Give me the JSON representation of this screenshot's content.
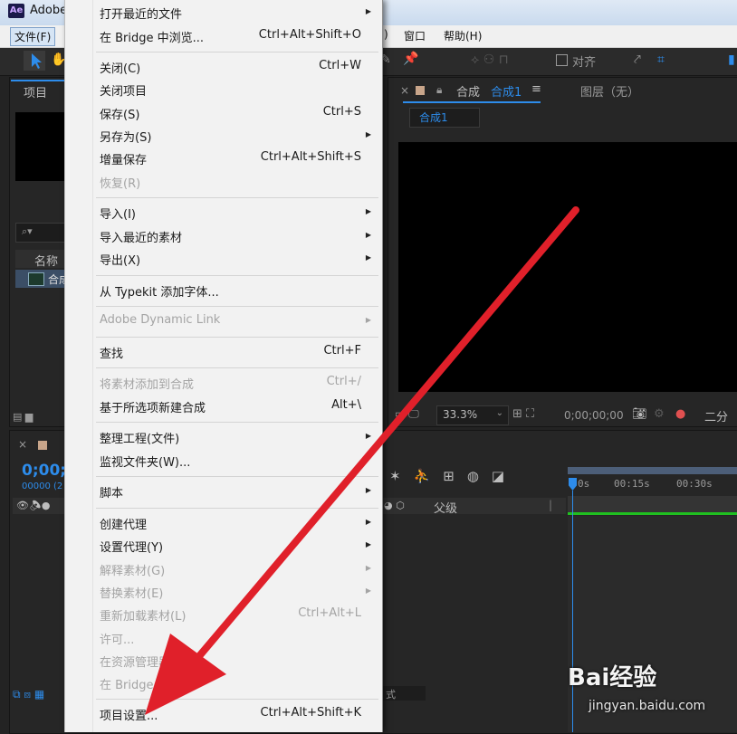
{
  "window": {
    "title": "Adobe"
  },
  "menubar": {
    "file": "文件(F)",
    "window": "窗口",
    "help": "帮助(H)",
    "partial": ")"
  },
  "toolbar": {
    "align": "对齐"
  },
  "project_panel": {
    "tab": "项目",
    "column_name": "名称",
    "item": "合成"
  },
  "comp_panel": {
    "tab_prefix": "合成",
    "tab_active": "合成1",
    "layer_tab": "图层（无）",
    "sub_tab": "合成1",
    "zoom": "33.3%",
    "timecode": "0;00;00;00",
    "resolution": "二分"
  },
  "timeline": {
    "timecode": "0;00;",
    "frame": "00000 (2",
    "parent_label": "父级",
    "ruler": [
      "0s",
      "00:15s",
      "00:30s"
    ],
    "footer": "式"
  },
  "file_menu": {
    "items": [
      {
        "label": "打开最近的文件",
        "shortcut": "",
        "submenu": true,
        "disabled": false
      },
      {
        "label": "在 Bridge 中浏览...",
        "shortcut": "Ctrl+Alt+Shift+O",
        "submenu": false,
        "disabled": false
      },
      {
        "label": "关闭(C)",
        "shortcut": "Ctrl+W",
        "submenu": false,
        "disabled": false
      },
      {
        "label": "关闭项目",
        "shortcut": "",
        "submenu": false,
        "disabled": false
      },
      {
        "label": "保存(S)",
        "shortcut": "Ctrl+S",
        "submenu": false,
        "disabled": false
      },
      {
        "label": "另存为(S)",
        "shortcut": "",
        "submenu": true,
        "disabled": false
      },
      {
        "label": "增量保存",
        "shortcut": "Ctrl+Alt+Shift+S",
        "submenu": false,
        "disabled": false
      },
      {
        "label": "恢复(R)",
        "shortcut": "",
        "submenu": false,
        "disabled": true
      },
      {
        "label": "导入(I)",
        "shortcut": "",
        "submenu": true,
        "disabled": false
      },
      {
        "label": "导入最近的素材",
        "shortcut": "",
        "submenu": true,
        "disabled": false
      },
      {
        "label": "导出(X)",
        "shortcut": "",
        "submenu": true,
        "disabled": false
      },
      {
        "label": "从 Typekit 添加字体...",
        "shortcut": "",
        "submenu": false,
        "disabled": false
      },
      {
        "label": "Adobe Dynamic Link",
        "shortcut": "",
        "submenu": true,
        "disabled": true
      },
      {
        "label": "查找",
        "shortcut": "Ctrl+F",
        "submenu": false,
        "disabled": false
      },
      {
        "label": "将素材添加到合成",
        "shortcut": "Ctrl+/",
        "submenu": false,
        "disabled": true
      },
      {
        "label": "基于所选项新建合成",
        "shortcut": "Alt+\\",
        "submenu": false,
        "disabled": false
      },
      {
        "label": "整理工程(文件)",
        "shortcut": "",
        "submenu": true,
        "disabled": false
      },
      {
        "label": "监视文件夹(W)...",
        "shortcut": "",
        "submenu": false,
        "disabled": false
      },
      {
        "label": "脚本",
        "shortcut": "",
        "submenu": true,
        "disabled": false
      },
      {
        "label": "创建代理",
        "shortcut": "",
        "submenu": true,
        "disabled": false
      },
      {
        "label": "设置代理(Y)",
        "shortcut": "",
        "submenu": true,
        "disabled": false
      },
      {
        "label": "解释素材(G)",
        "shortcut": "",
        "submenu": true,
        "disabled": true
      },
      {
        "label": "替换素材(E)",
        "shortcut": "",
        "submenu": true,
        "disabled": true
      },
      {
        "label": "重新加载素材(L)",
        "shortcut": "Ctrl+Alt+L",
        "submenu": false,
        "disabled": true
      },
      {
        "label": "许可...",
        "shortcut": "",
        "submenu": false,
        "disabled": true
      },
      {
        "label": "在资源管理器",
        "shortcut": "",
        "submenu": false,
        "disabled": true
      },
      {
        "label": "在 Bridge",
        "shortcut": "",
        "submenu": false,
        "disabled": true
      },
      {
        "label": "项目设置...",
        "shortcut": "Ctrl+Alt+Shift+K",
        "submenu": false,
        "disabled": false
      }
    ]
  },
  "watermark": {
    "brand": "Bai经验",
    "url": "jingyan.baidu.com"
  },
  "colors": {
    "arrow": "#e0202a",
    "accent": "#2d8ceb",
    "green": "#20c020"
  }
}
